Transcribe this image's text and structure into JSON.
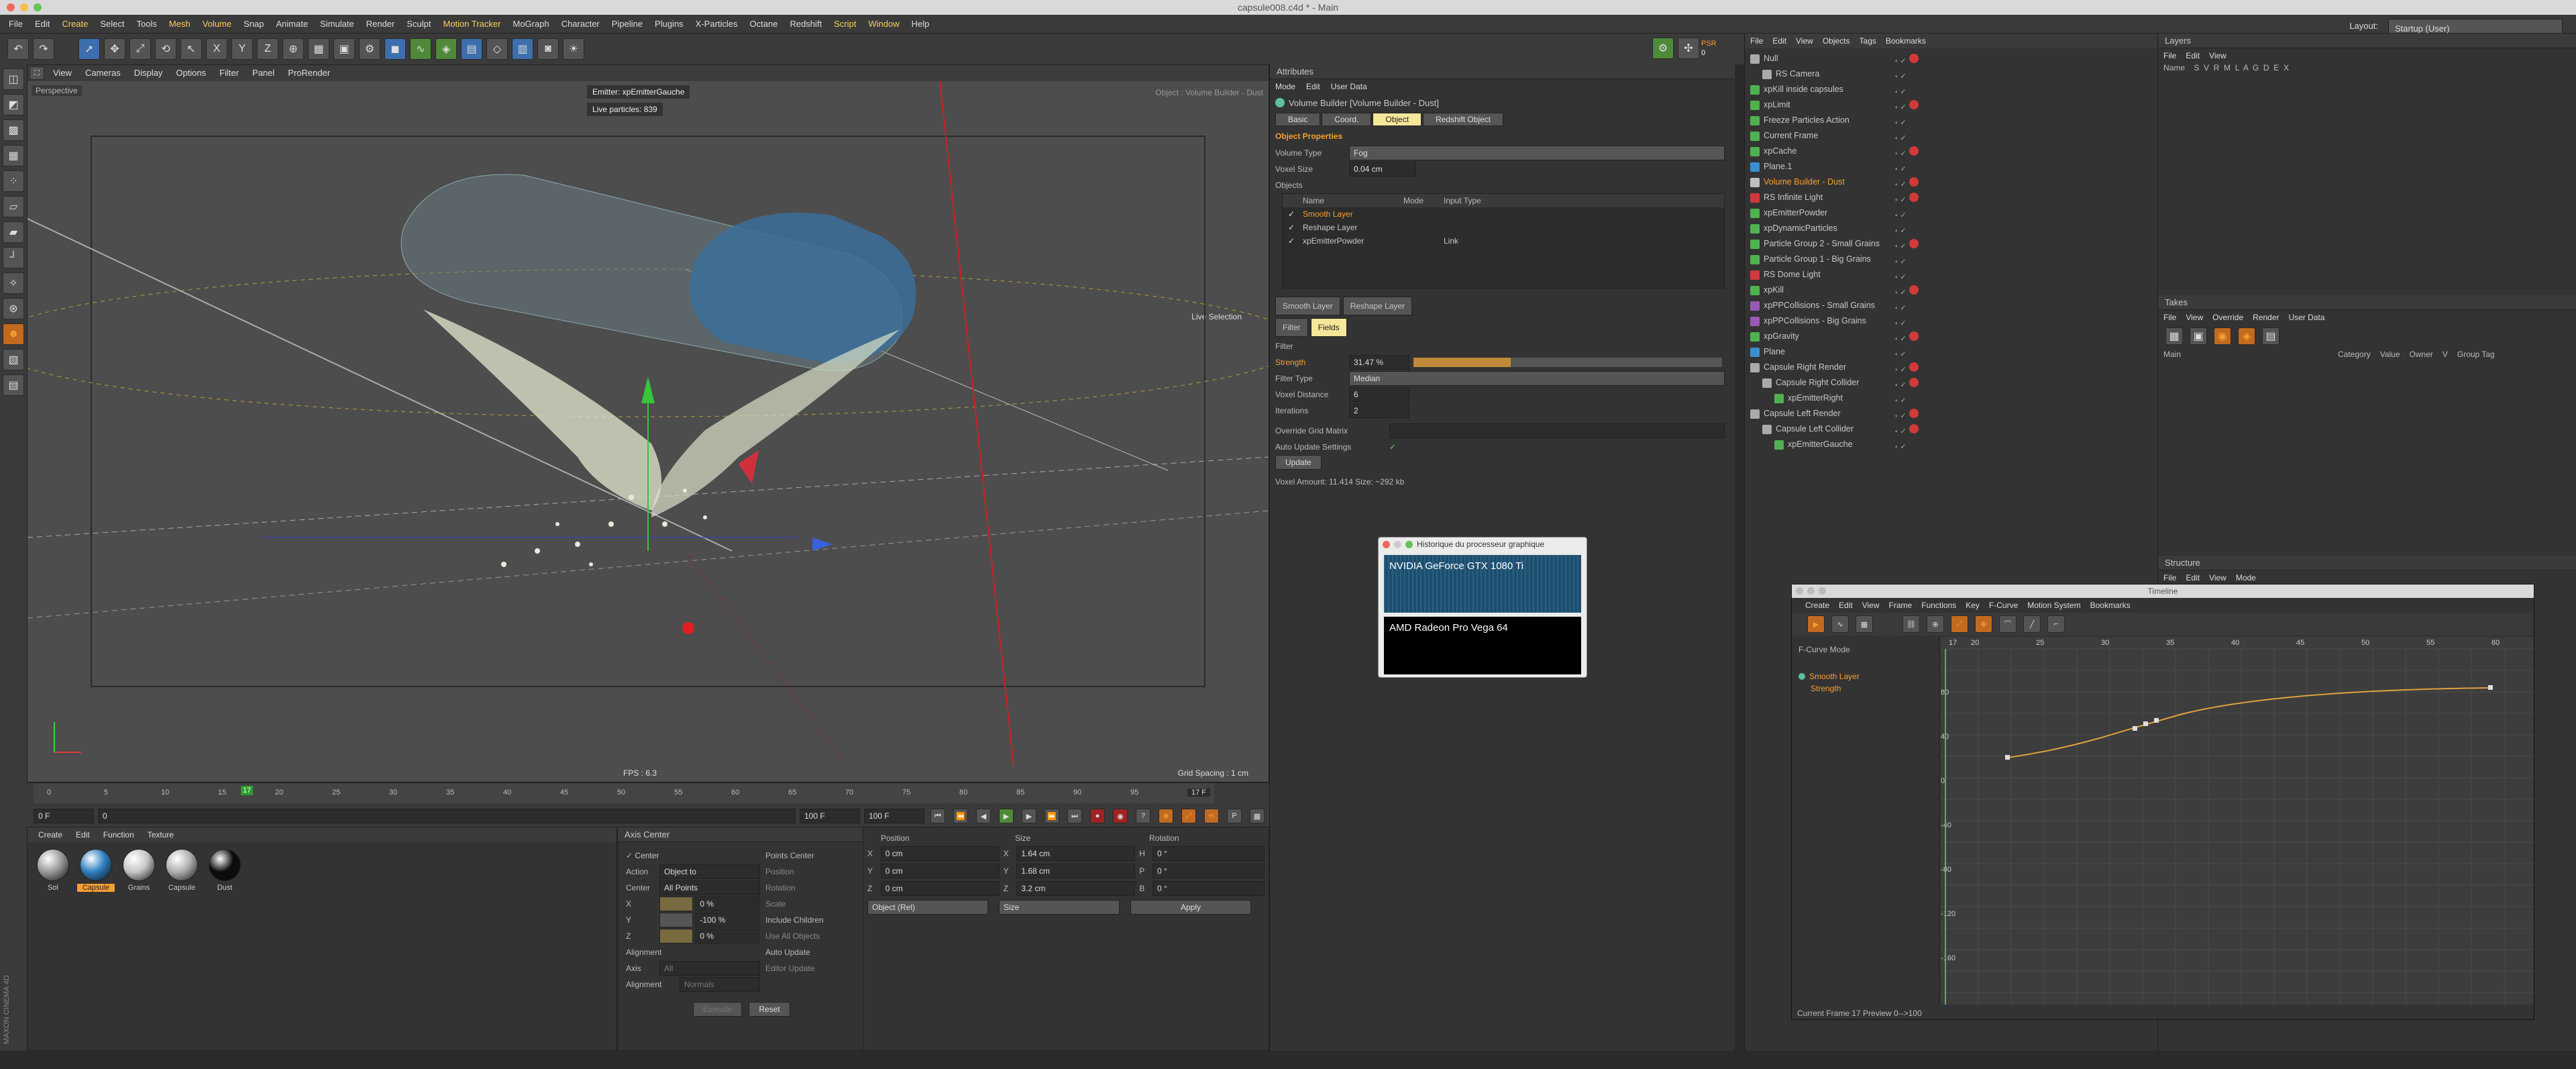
{
  "window": {
    "title": "capsule008.c4d * - Main"
  },
  "menu": [
    "File",
    "Edit",
    "Create",
    "Select",
    "Tools",
    "Mesh",
    "Volume",
    "Snap",
    "Animate",
    "Simulate",
    "Render",
    "Sculpt",
    "Motion Tracker",
    "MoGraph",
    "Character",
    "Pipeline",
    "Plugins",
    "X-Particles",
    "Octane",
    "Redshift",
    "Script",
    "Window",
    "Help"
  ],
  "layout": {
    "label": "Layout:",
    "value": "Startup (User)"
  },
  "psr": {
    "label": "PSR",
    "value": "0"
  },
  "viewport": {
    "menu": [
      "View",
      "Cameras",
      "Display",
      "Options",
      "Filter",
      "Panel",
      "ProRender"
    ],
    "name": "Perspective",
    "emitter": "Emitter: xpEmitterGauche",
    "particles": "Live particles: 839",
    "object_label": "Object : Volume Builder - Dust",
    "selection_label": "Live Selection",
    "fps": "FPS : 6.3",
    "grid": "Grid Spacing : 1 cm"
  },
  "timeline": {
    "ticks": [
      "0",
      "5",
      "10",
      "15",
      "20",
      "25",
      "30",
      "35",
      "40",
      "45",
      "50",
      "55",
      "60",
      "65",
      "70",
      "75",
      "80",
      "85",
      "90",
      "95",
      "100"
    ],
    "current": "17",
    "current_label": "17 F",
    "start": "0 F",
    "end_field": "100 F",
    "end_field2": "100 F",
    "min_field": "0",
    "progress": 0.17
  },
  "materials": {
    "menu": [
      "Create",
      "Edit",
      "Function",
      "Texture"
    ],
    "items": [
      {
        "name": "Sol",
        "color": "#9a9a9a"
      },
      {
        "name": "Capsule",
        "color": "#2f7fc1"
      },
      {
        "name": "Grains",
        "color": "#c6c6c6"
      },
      {
        "name": "Capsule",
        "color": "#b0b0b0"
      },
      {
        "name": "Dust",
        "color": "#0a0a0a"
      }
    ]
  },
  "axis": {
    "title": "Axis Center",
    "center_label": "Center",
    "action_label": "Action",
    "action_value": "Object to",
    "center_select_label": "Center",
    "center_select_value": "All Points",
    "x_label": "X",
    "x_value": "0 %",
    "y_label": "Y",
    "y_value": "-100 %",
    "z_label": "Z",
    "z_value": "0 %",
    "points_center": "Points Center",
    "position": "Position",
    "rotation": "Rotation",
    "scale": "Scale",
    "include_children": "Include Children",
    "use_all_objects": "Use All Objects",
    "auto_update": "Auto Update",
    "editor_update": "Editor Update",
    "alignment_title": "Alignment",
    "axis_label": "Axis",
    "axis_value": "All",
    "alignment_label": "Alignment",
    "alignment_value": "Normals",
    "execute": "Execute",
    "reset": "Reset"
  },
  "coords": {
    "position_title": "Position",
    "size_title": "Size",
    "rotation_title": "Rotation",
    "rows": [
      {
        "axis": "X",
        "pos": "0 cm",
        "size": "1.64 cm",
        "rlabel": "H",
        "rot": "0 °"
      },
      {
        "axis": "Y",
        "pos": "0 cm",
        "size": "1.68 cm",
        "rlabel": "P",
        "rot": "0 °"
      },
      {
        "axis": "Z",
        "pos": "0 cm",
        "size": "3.2 cm",
        "rlabel": "B",
        "rot": "0 °"
      }
    ],
    "mode": "Object (Rel)",
    "size_mode": "Size",
    "apply": "Apply"
  },
  "attributes": {
    "title": "Attributes",
    "menu": [
      "Mode",
      "Edit",
      "User Data"
    ],
    "object_title": "Volume Builder [Volume Builder - Dust]",
    "tabs": [
      "Basic",
      "Coord.",
      "Object",
      "Redshift Object"
    ],
    "active_tab": "Object",
    "section": "Object Properties",
    "volume_type_label": "Volume Type",
    "volume_type": "Fog",
    "voxel_size_label": "Voxel Size",
    "voxel_size": "0.04 cm",
    "objects_label": "Objects",
    "col_name": "Name",
    "col_mode": "Mode",
    "col_input": "Input Type",
    "objects": [
      {
        "name": "Smooth Layer",
        "mode": "",
        "input": ""
      },
      {
        "name": "Reshape Layer",
        "mode": "",
        "input": ""
      },
      {
        "name": "xpEmitterPowder",
        "mode": "",
        "input": "Link"
      }
    ],
    "layer_tabs": [
      "Smooth Layer",
      "Reshape Layer"
    ],
    "sub_tabs": [
      "Filter",
      "Fields"
    ],
    "filter_title": "Filter",
    "strength_label": "Strength",
    "strength": "31.47 %",
    "strength_frac": 0.3147,
    "filter_type_label": "Filter Type",
    "filter_type": "Median",
    "voxel_distance_label": "Voxel Distance",
    "voxel_distance": "6",
    "iterations_label": "Iterations",
    "iterations": "2",
    "override_label": "Override Grid Matrix",
    "auto_update_label": "Auto Update Settings",
    "update_btn": "Update",
    "voxel_info": "Voxel Amount: 11.414    Size: ~292 kb"
  },
  "objects_panel": {
    "menu": [
      "File",
      "Edit",
      "View",
      "Objects",
      "Tags",
      "Bookmarks"
    ],
    "items": [
      {
        "name": "Null",
        "color": "#aaaaaa",
        "indent": 0,
        "style": ""
      },
      {
        "name": "RS Camera",
        "color": "#aaaaaa",
        "indent": 1,
        "style": ""
      },
      {
        "name": "xpKill inside capsules",
        "color": "#4fb24f",
        "indent": 0,
        "style": ""
      },
      {
        "name": "xpLimit",
        "color": "#4fb24f",
        "indent": 0,
        "style": ""
      },
      {
        "name": "Freeze Particles Action",
        "color": "#4fb24f",
        "indent": 0,
        "style": ""
      },
      {
        "name": "Current Frame",
        "color": "#4fb24f",
        "indent": 0,
        "style": ""
      },
      {
        "name": "xpCache",
        "color": "#4fb24f",
        "indent": 0,
        "style": ""
      },
      {
        "name": "Plane.1",
        "color": "#3a8fd0",
        "indent": 0,
        "style": ""
      },
      {
        "name": "Volume Builder - Dust",
        "color": "#c0c0c0",
        "indent": 0,
        "style": "orange"
      },
      {
        "name": "RS Infinite Light",
        "color": "#d03a3a",
        "indent": 0,
        "style": ""
      },
      {
        "name": "xpEmitterPowder",
        "color": "#4fb24f",
        "indent": 0,
        "style": ""
      },
      {
        "name": "xpDynamicParticles",
        "color": "#4fb24f",
        "indent": 0,
        "style": ""
      },
      {
        "name": "Particle Group 2 - Small Grains",
        "color": "#4fb24f",
        "indent": 0,
        "style": ""
      },
      {
        "name": "Particle Group 1 - Big Grains",
        "color": "#4fb24f",
        "indent": 0,
        "style": ""
      },
      {
        "name": "RS Dome Light",
        "color": "#d03a3a",
        "indent": 0,
        "style": ""
      },
      {
        "name": "xpKill",
        "color": "#4fb24f",
        "indent": 0,
        "style": ""
      },
      {
        "name": "xpPPCollisions - Small Grains",
        "color": "#9b59b6",
        "indent": 0,
        "style": ""
      },
      {
        "name": "xpPPCollisions - Big Grains",
        "color": "#9b59b6",
        "indent": 0,
        "style": ""
      },
      {
        "name": "xpGravity",
        "color": "#4fb24f",
        "indent": 0,
        "style": ""
      },
      {
        "name": "Plane",
        "color": "#3a8fd0",
        "indent": 0,
        "style": ""
      },
      {
        "name": "Capsule Right Render",
        "color": "#aaaaaa",
        "indent": 0,
        "style": ""
      },
      {
        "name": "Capsule Right Collider",
        "color": "#aaaaaa",
        "indent": 1,
        "style": ""
      },
      {
        "name": "xpEmitterRight",
        "color": "#4fb24f",
        "indent": 2,
        "style": ""
      },
      {
        "name": "Capsule Left Render",
        "color": "#aaaaaa",
        "indent": 0,
        "style": ""
      },
      {
        "name": "Capsule Left Collider",
        "color": "#aaaaaa",
        "indent": 1,
        "style": ""
      },
      {
        "name": "xpEmitterGauche",
        "color": "#4fb24f",
        "indent": 2,
        "style": ""
      }
    ]
  },
  "layers": {
    "title": "Layers",
    "menu": [
      "File",
      "Edit",
      "View"
    ],
    "header": "Name    S  V  R  M  L  A  G  D  E  X",
    "takes_title": "Takes",
    "takes_menu": [
      "File",
      "View",
      "Override",
      "Render",
      "User Data"
    ],
    "takes_main": "Main",
    "takes_cols": [
      "Category",
      "Value",
      "Owner",
      "V",
      "Group Tag"
    ],
    "structure_title": "Structure",
    "structure_menu": [
      "File",
      "Edit",
      "View",
      "Mode"
    ]
  },
  "gpu": {
    "title": "Historique du processeur graphique",
    "cards": [
      {
        "name": "NVIDIA GeForce GTX 1080 Ti"
      },
      {
        "name": "AMD Radeon Pro Vega 64"
      }
    ]
  },
  "timeline_window": {
    "title": "Timeline",
    "menu": [
      "Create",
      "Edit",
      "View",
      "Frame",
      "Functions",
      "Key",
      "F-Curve",
      "Motion System",
      "Bookmarks"
    ],
    "mode": "F-Curve Mode",
    "track": "Smooth Layer",
    "track_sub": "Strength",
    "ruler": [
      "17",
      "20",
      "25",
      "30",
      "35",
      "40",
      "45",
      "50",
      "55",
      "60"
    ],
    "yticks": [
      "80",
      "40",
      "0",
      "-40",
      "-80",
      "-120",
      "-160"
    ],
    "status": "Current Frame  17  Preview  0-->100"
  },
  "branding": {
    "vertical": "MAXON CINEMA 4D"
  }
}
